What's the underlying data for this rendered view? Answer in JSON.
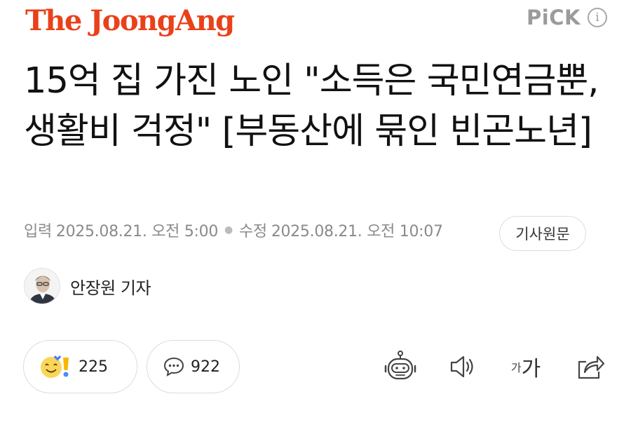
{
  "header": {
    "logo_text": "The JoongAng",
    "pick_label": "PiCK",
    "info_label": "i",
    "brand_color": "#e9411a"
  },
  "article": {
    "headline": "15억 집 가진 노인 \"소득은 국민연금뿐, 생활비 걱정\" [부동산에 묶인 빈곤노년]",
    "meta": {
      "input_label": "입력",
      "input_time": "2025.08.21. 오전 5:00",
      "updated_label": "수정",
      "updated_time": "2025.08.21. 오전 10:07"
    },
    "original_button": "기사원문",
    "reporter": "안장원 기자"
  },
  "actions": {
    "reactions_count": "225",
    "comments_count": "922",
    "font_small": "가",
    "font_large": "가"
  },
  "icons": [
    "pick-logo",
    "info-icon",
    "reporter-avatar",
    "smile-emoji-icon",
    "exclamation-icon",
    "comment-icon",
    "summary-bot-icon",
    "speaker-icon",
    "font-size-icon",
    "share-icon"
  ]
}
